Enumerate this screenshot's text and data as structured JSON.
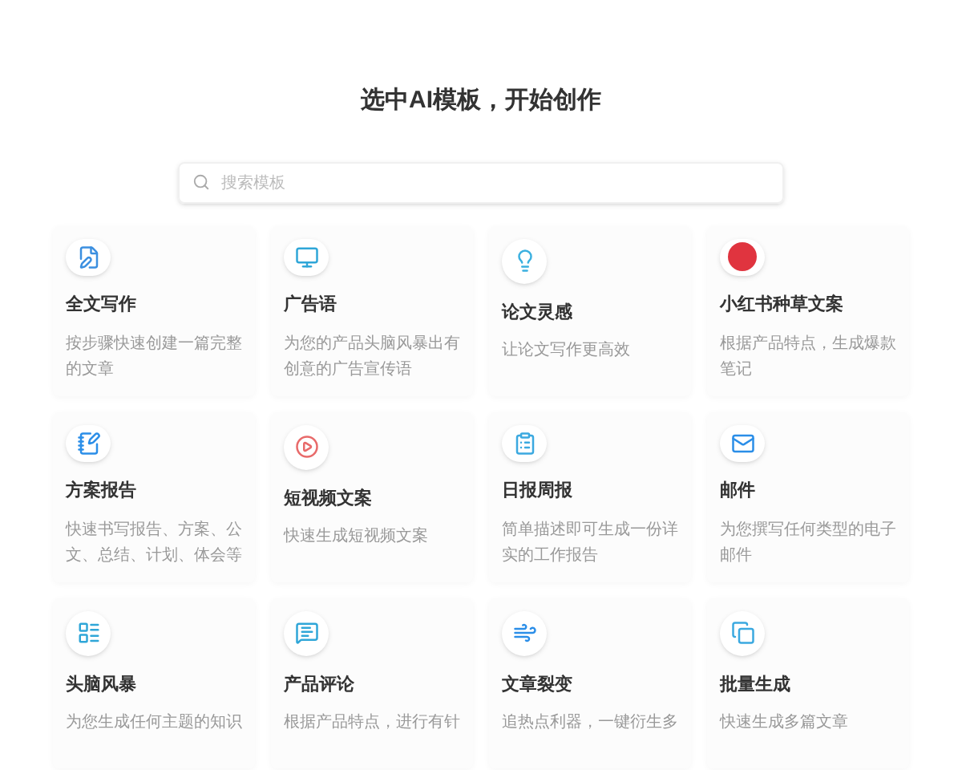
{
  "title": "选中AI模板，开始创作",
  "search": {
    "placeholder": "搜索模板"
  },
  "templates": [
    {
      "name": "全文写作",
      "description": "按步骤快速创建一篇完整的文章"
    },
    {
      "name": "广告语",
      "description": "为您的产品头脑风暴出有创意的广告宣传语"
    },
    {
      "name": "论文灵感",
      "description": "让论文写作更高效"
    },
    {
      "name": "小红书种草文案",
      "description": "根据产品特点，生成爆款笔记"
    },
    {
      "name": "方案报告",
      "description": "快速书写报告、方案、公文、总结、计划、体会等"
    },
    {
      "name": "短视频文案",
      "description": "快速生成短视频文案"
    },
    {
      "name": "日报周报",
      "description": "简单描述即可生成一份详实的工作报告"
    },
    {
      "name": "邮件",
      "description": "为您撰写任何类型的电子邮件"
    },
    {
      "name": "头脑风暴",
      "description": "为您生成任何主题的知识"
    },
    {
      "name": "产品评论",
      "description": "根据产品特点，进行有针"
    },
    {
      "name": "文章裂变",
      "description": "追热点利器，一键衍生多"
    },
    {
      "name": "批量生成",
      "description": "快速生成多篇文章"
    }
  ]
}
